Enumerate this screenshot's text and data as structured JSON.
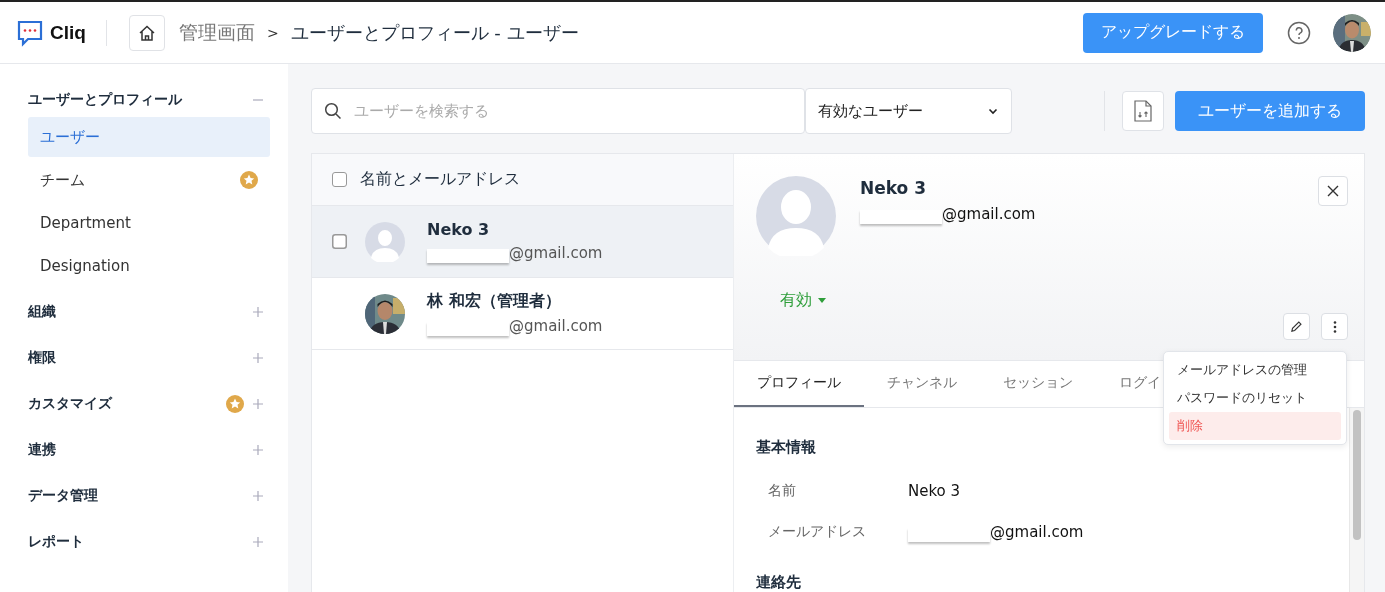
{
  "header": {
    "logo": "Cliq",
    "breadcrumb": {
      "root": "管理画面",
      "separator": ">",
      "current": "ユーザーとプロフィール - ユーザー"
    },
    "upgrade_button": "アップグレードする"
  },
  "sidebar": {
    "sections": [
      {
        "label": "ユーザーとプロフィール",
        "expanded": true,
        "premium": false,
        "items": [
          {
            "label": "ユーザー",
            "selected": true,
            "premium": false
          },
          {
            "label": "チーム",
            "selected": false,
            "premium": true
          },
          {
            "label": "Department",
            "selected": false,
            "premium": false
          },
          {
            "label": "Designation",
            "selected": false,
            "premium": false
          }
        ]
      },
      {
        "label": "組織",
        "expanded": false,
        "premium": false
      },
      {
        "label": "権限",
        "expanded": false,
        "premium": false
      },
      {
        "label": "カスタマイズ",
        "expanded": false,
        "premium": true
      },
      {
        "label": "連携",
        "expanded": false,
        "premium": false
      },
      {
        "label": "データ管理",
        "expanded": false,
        "premium": false
      },
      {
        "label": "レポート",
        "expanded": false,
        "premium": false
      }
    ]
  },
  "toolbar": {
    "search": {
      "placeholder": "ユーザーを検索する"
    },
    "filter": "有効なユーザー",
    "add_button": "ユーザーを追加する"
  },
  "user_list": {
    "header": "名前とメールアドレス",
    "header_checked": false,
    "rows": [
      {
        "name": "Neko 3",
        "email": "@gmail.com",
        "kind": "default",
        "selected": true,
        "checked": false
      },
      {
        "name": "林 和宏（管理者）",
        "email": "@gmail.com",
        "selected": false
      }
    ]
  },
  "detail": {
    "name": "Neko 3",
    "email": "@gmail.com",
    "status": "有効",
    "tabs": [
      {
        "label": "プロフィール",
        "selected": true
      },
      {
        "label": "チャンネル",
        "selected": false
      },
      {
        "label": "セッション",
        "selected": false
      },
      {
        "label": "ログイ",
        "selected": false
      }
    ],
    "section": "基本情報",
    "fields": [
      {
        "label": "名前",
        "value": "Neko 3",
        "redacted": false
      },
      {
        "label": "メールアドレス",
        "value": "@gmail.com",
        "redacted": true
      }
    ],
    "next_section": "連絡先",
    "menu": [
      {
        "label": "メールアドレスの管理",
        "danger": false
      },
      {
        "label": "パスワードのリセット",
        "danger": false
      },
      {
        "label": "削除",
        "danger": true
      }
    ]
  }
}
